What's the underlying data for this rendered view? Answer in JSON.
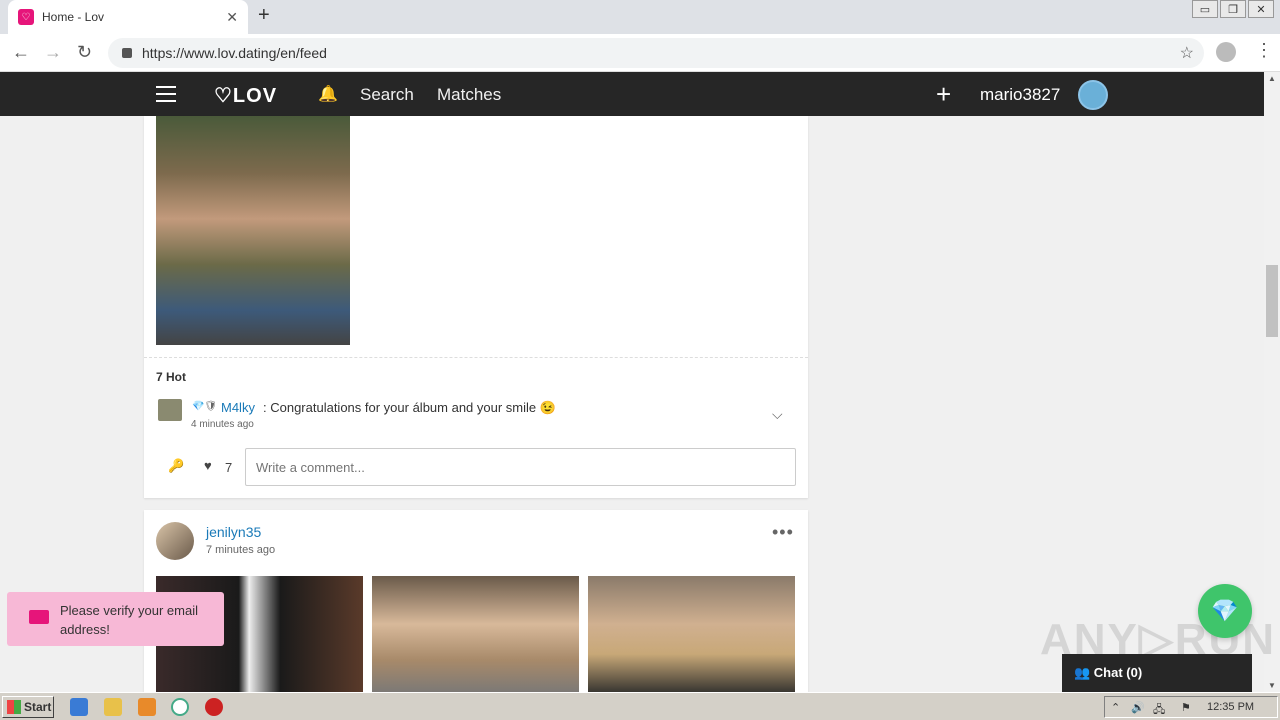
{
  "browser": {
    "tab_title": "Home - Lov",
    "tab_favicon": "♡",
    "close_tab": "✕",
    "new_tab": "+",
    "url": "https://www.lov.dating/en/feed",
    "back": "←",
    "forward": "→",
    "reload": "↻",
    "bookmark": "☆",
    "menu": "⋮",
    "win_min": "▭",
    "win_restore": "❐",
    "win_close": "✕"
  },
  "header": {
    "logo": "♡LOV",
    "bell": "🔔",
    "nav": [
      "Search",
      "Matches"
    ],
    "add": "+",
    "username": "mario3827"
  },
  "post1": {
    "hot_count": "7 Hot",
    "comment": {
      "badges": "💎🛡",
      "author": "M4lky",
      "text": ": Congratulations for your álbum and your smile 😉",
      "time": "4 minutes ago",
      "expand": "⌵"
    },
    "pin_icon": "🔑",
    "heart_icon": "♥",
    "likes": "7",
    "comment_placeholder": "Write a comment..."
  },
  "post2": {
    "author": "jenilyn35",
    "time": "7 minutes ago",
    "more": "•••"
  },
  "toast": {
    "message": "Please verify your email address!"
  },
  "floating": {
    "diamond": "💎",
    "chat_label": "👥 Chat (0)",
    "watermark": "ANY▷RUN"
  },
  "taskbar": {
    "start": "Start",
    "clock": "12:35 PM",
    "tray_icons": [
      "⌃",
      "🔊",
      "🖧",
      "⚑"
    ]
  },
  "scroll": {
    "up": "▲",
    "down": "▼"
  }
}
